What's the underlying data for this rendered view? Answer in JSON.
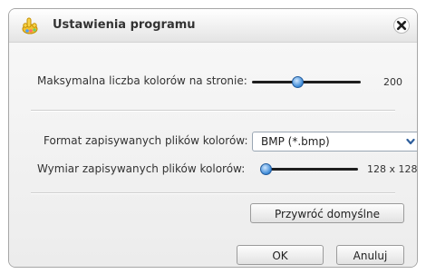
{
  "dialog": {
    "title": "Ustawienia programu",
    "icon": "app-hand-icon",
    "close_icon": "close-icon"
  },
  "settings": {
    "max_colors": {
      "label": "Maksymalna liczba kolorów na stronie:",
      "value_text": "200",
      "slider_fraction": 0.42
    },
    "save_format": {
      "label": "Format zapisywanych plików kolorów:",
      "selected": "BMP (*.bmp)"
    },
    "save_size": {
      "label": "Wymiar zapisywanych plików kolorów:",
      "value_text": "128 x 128",
      "slider_fraction": 0.05
    }
  },
  "buttons": {
    "restore_defaults": "Przywróć domyślne",
    "ok": "OK",
    "cancel": "Anuluj"
  },
  "colors": {
    "accent": "#3a88d6",
    "dropdown_arrow": "#2f5f9c"
  }
}
